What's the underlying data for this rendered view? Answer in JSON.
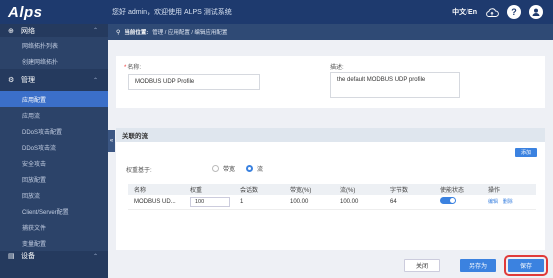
{
  "header": {
    "logo": "Alps",
    "welcome": "您好 admin，欢迎使用 ALPS 测试系统",
    "lang_cn": "中文",
    "lang_sep": "/",
    "lang_en": "En",
    "help_glyph": "?",
    "user_glyph": "●"
  },
  "sidebar": {
    "network_label": "网络",
    "network_items": [
      "网络拓扑列表",
      "创建网络拓扑"
    ],
    "manage_label": "管理",
    "manage_items": [
      "应用配置",
      "应用流",
      "DDoS攻击配置",
      "DDoS攻击流",
      "安全攻击",
      "回放配置",
      "回放流",
      "Client/Server配置",
      "捕获文件",
      "变量配置"
    ],
    "active_item": "应用配置",
    "device_label": "设备"
  },
  "breadcrumb": {
    "label": "当前位置:",
    "path": "管理 / 应用配置 / 编辑应用配置"
  },
  "form": {
    "name_label": "名称:",
    "name_value": "MODBUS UDP Profile",
    "desc_label": "描述:",
    "desc_value": "the default MODBUS UDP profile"
  },
  "associated": {
    "title": "关联的流",
    "add_label": "添加",
    "weight_basis_label": "权重基于:",
    "radio_bandwidth": "带宽",
    "radio_flow": "流",
    "selected": "流",
    "columns": [
      "名称",
      "权重",
      "会话数",
      "带宽(%)",
      "流(%)",
      "字节数",
      "使能状态",
      "操作"
    ],
    "rows": [
      {
        "name": "MODBUS UD...",
        "weight": "100",
        "sessions": "1",
        "bandwidth": "100.00",
        "flow": "100.00",
        "bytes": "64",
        "enabled": true,
        "op_edit": "编辑",
        "op_delete": "删除"
      }
    ]
  },
  "footer": {
    "close_label": "关闭",
    "save_as_label": "另存为",
    "save_label": "保存"
  },
  "colors": {
    "topbar": "#1e3a6e",
    "sidebar": "#253a5e",
    "active": "#3b6fc9",
    "accent": "#3b82e0",
    "highlight": "#e03a3a"
  }
}
